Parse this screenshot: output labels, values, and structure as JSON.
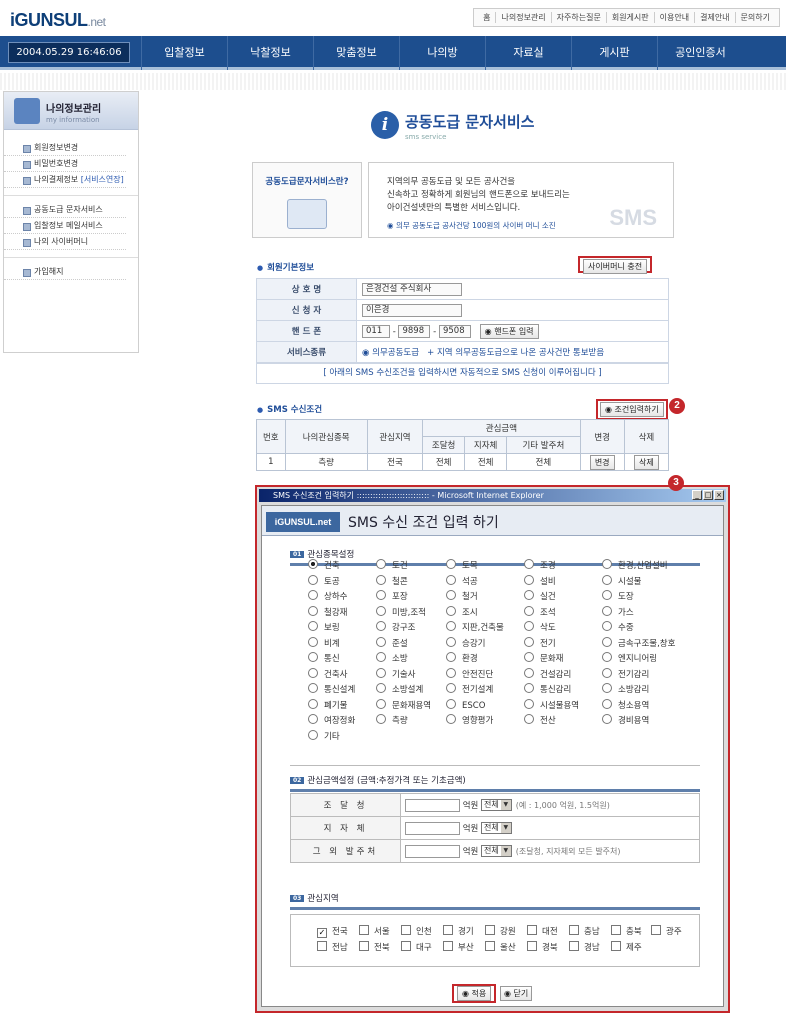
{
  "logo": {
    "text": "iGUNSUL",
    "suffix": ".net"
  },
  "toplinks": [
    "홈",
    "나의정보관리",
    "자주하는질문",
    "회원게시판",
    "이용안내",
    "결제안내",
    "문의하기"
  ],
  "clock": "2004.05.29 16:46:06",
  "menu": [
    "입찰정보",
    "낙찰정보",
    "맞춤정보",
    "나의방",
    "자료실",
    "게시판",
    "공인인증서"
  ],
  "sidebar": {
    "title": "나의정보관리",
    "subtitle": "my information",
    "group1": [
      "회원정보변경",
      "비밀번호변경",
      "나의결제정보"
    ],
    "group1_hl": "[서비스연장]",
    "group2": [
      "공동도급 문자서비스",
      "입찰정보 메일서비스",
      "나의 사이버머니"
    ],
    "group3": [
      "가입해지"
    ]
  },
  "page_title": {
    "title": "공동도급 문자서비스",
    "subtitle": "sms service"
  },
  "info": {
    "left_title": "공동도급문자서비스란?",
    "lines": [
      "지역의무 공동도급 및 모든 공사건을",
      "신속하고 정확하게 회원님의 핸드폰으로 보내드리는",
      "아이건설넷만의 특별한 서비스입니다."
    ],
    "link": "의무 공동도급 공사건당 100원의 사이버 머니 소진",
    "watermark": "SMS"
  },
  "member": {
    "section": "회원기본정보",
    "cyber_btn": "사이버머니 충전",
    "rows": {
      "company_label": "상 호 명",
      "company": "은경건설 주식회사",
      "applicant_label": "신 청 자",
      "applicant": "이은경",
      "phone_label": "핸 드 폰",
      "phone1": "011",
      "phone2": "9898",
      "phone3": "9508",
      "phone_btn": "핸드폰 입력",
      "service_label": "서비스종류",
      "service": "의무공동도급",
      "service_note": "+ 지역 의무공동도급으로 나온 공사건만 통보받음"
    },
    "notice": "[ 아래의 SMS 수신조건을 입력하시면 자동적으로 SMS 신청이 이루어집니다 ]"
  },
  "sms_cond": {
    "section": "SMS 수신조건",
    "btn": "조건입력하기",
    "headers": {
      "no": "번호",
      "category": "나의관심종목",
      "region": "관심지역",
      "amount": "관심금액",
      "procurement": "조달청",
      "local": "지자체",
      "other": "기타 발주처",
      "edit": "변경",
      "del": "삭제"
    },
    "row": {
      "no": "1",
      "category": "측량",
      "region": "전국",
      "procurement": "전체",
      "local": "전체",
      "other": "전체",
      "edit_btn": "변경",
      "del_btn": "삭제"
    }
  },
  "markers": [
    "2",
    "3"
  ],
  "popup": {
    "window_title": "SMS 수신조건 입력하기 ::::::::::::::::::::::::::: - Microsoft Internet Explorer",
    "logo": "iGUNSUL.net",
    "title": "SMS 수신 조건 입력 하기",
    "sec1": "관심종목설정",
    "sec2": "관심금액설정 (금액:추정가격 또는 기초금액)",
    "sec3": "관심지역",
    "categories": [
      "건축",
      "토건",
      "토목",
      "조경",
      "환경,산업설비",
      "토공",
      "철콘",
      "석공",
      "설비",
      "시설물",
      "상하수",
      "포장",
      "철거",
      "실건",
      "도장",
      "철강재",
      "미방,조적",
      "조시",
      "조석",
      "가스",
      "보링",
      "강구조",
      "지판,건축물",
      "삭도",
      "수중",
      "비계",
      "준설",
      "승강기",
      "전기",
      "금속구조물,창호",
      "통신",
      "소방",
      "환경",
      "문화재",
      "엔지니어링",
      "건축사",
      "기술사",
      "안전진단",
      "건설감리",
      "전기감리",
      "통신설계",
      "소방설계",
      "전기설계",
      "통신감리",
      "소방감리",
      "폐기물",
      "문화재용역",
      "ESCO",
      "시설물용역",
      "청소용역",
      "여장정화",
      "측량",
      "영향평가",
      "전산",
      "경비용역",
      "기타"
    ],
    "amounts": [
      {
        "label": "조 달 청",
        "unit": "억원",
        "sel": "전체",
        "ex": "(예 : 1,000 억원, 1.5억원)"
      },
      {
        "label": "지 자 체",
        "unit": "억원",
        "sel": "전체",
        "ex": ""
      },
      {
        "label": "그 외 발주처",
        "unit": "억원",
        "sel": "전체",
        "ex": "(조달청, 지자체외 모든 발주처)"
      }
    ],
    "regions": [
      "전국",
      "서울",
      "인천",
      "경기",
      "강원",
      "대전",
      "충남",
      "충북",
      "광주",
      "전남",
      "전북",
      "대구",
      "부산",
      "울산",
      "경북",
      "경남",
      "제주"
    ],
    "apply": "적용",
    "close": "닫기"
  }
}
